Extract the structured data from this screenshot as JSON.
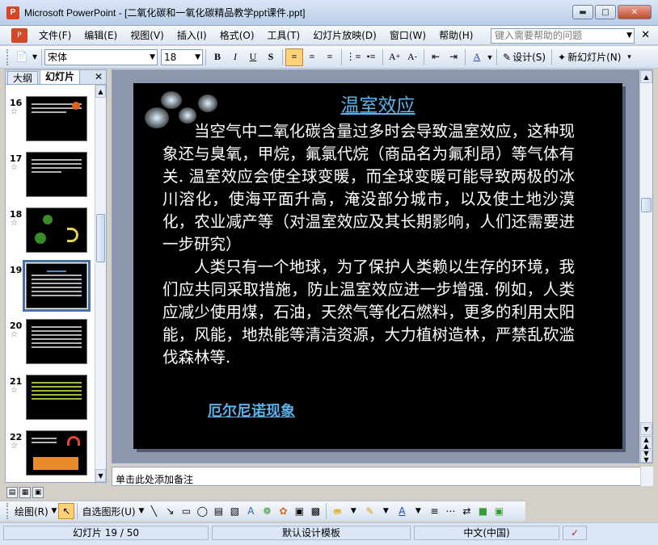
{
  "window": {
    "title": "Microsoft PowerPoint - [二氧化碳和一氧化碳精品教学ppt课件.ppt]",
    "app_icon": "powerpoint-icon",
    "controls": [
      "minimize",
      "maximize",
      "close"
    ]
  },
  "menubar": {
    "items": [
      "文件(F)",
      "编辑(E)",
      "视图(V)",
      "插入(I)",
      "格式(O)",
      "工具(T)",
      "幻灯片放映(D)",
      "窗口(W)",
      "帮助(H)"
    ],
    "help_placeholder": "键入需要帮助的问题"
  },
  "toolbar": {
    "font_name": "宋体",
    "font_size": "18",
    "bold": "B",
    "italic": "I",
    "underline": "U",
    "shadow": "S",
    "design_label": "设计(S)",
    "new_slide_label": "新幻灯片(N)"
  },
  "leftpane": {
    "tabs": [
      "大纲",
      "幻灯片"
    ],
    "active_tab": "幻灯片",
    "thumbnails": [
      {
        "num": "16",
        "selected": false
      },
      {
        "num": "17",
        "selected": false
      },
      {
        "num": "18",
        "selected": false
      },
      {
        "num": "19",
        "selected": true
      },
      {
        "num": "20",
        "selected": false
      },
      {
        "num": "21",
        "selected": false
      },
      {
        "num": "22",
        "selected": false
      }
    ]
  },
  "slide": {
    "title": "温室效应",
    "paragraph1": "当空气中二氧化碳含量过多时会导致温室效应，这种现象还与臭氧，甲烷，氟氯代烷（商品名为氟利昂）等气体有关.  温室效应会使全球变暖，而全球变暖可能导致两极的冰川溶化，使海平面升高，淹没部分城市，以及使土地沙漠化，农业减产等（对温室效应及其长期影响，人们还需要进一步研究）",
    "paragraph2": "人类只有一个地球，为了保护人类赖以生存的环境，我们应共同采取措施，防止温室效应进一步增强. 例如，人类应减少使用煤，石油，天然气等化石燃料，更多的利用太阳能，风能，地热能等清洁资源，大力植树造林，严禁乱砍滥伐森林等.",
    "link": "厄尔尼诺现象"
  },
  "notes": {
    "placeholder": "单击此处添加备注"
  },
  "drawbar": {
    "draw_label": "绘图(R)",
    "autoshapes_label": "自选图形(U)"
  },
  "status": {
    "slide_info": "幻灯片 19 / 50",
    "template": "默认设计模板",
    "language": "中文(中国)"
  }
}
